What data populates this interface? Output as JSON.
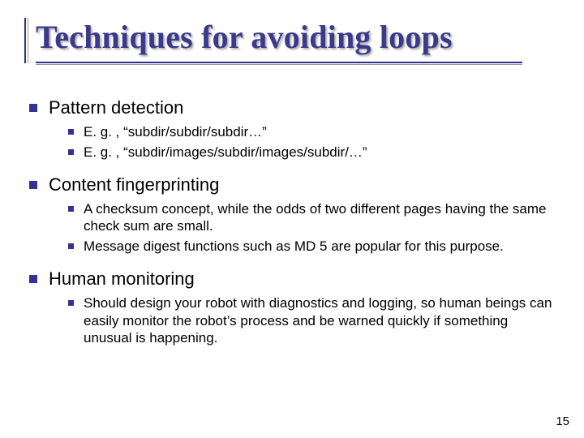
{
  "title": "Techniques for avoiding loops",
  "sections": [
    {
      "heading": "Pattern detection",
      "items": [
        "E. g. , “subdir/subdir/subdir…”",
        "E. g. , “subdir/images/subdir/images/subdir/…”"
      ]
    },
    {
      "heading": "Content fingerprinting",
      "items": [
        "A checksum concept, while the odds of two different pages having the same check sum are small.",
        "Message digest functions such as MD 5 are popular for this purpose."
      ]
    },
    {
      "heading": "Human monitoring",
      "items": [
        "Should design your robot with diagnostics and logging, so human beings can easily monitor the robot’s process and be warned quickly if something unusual is happening."
      ]
    }
  ],
  "page_number": "15"
}
